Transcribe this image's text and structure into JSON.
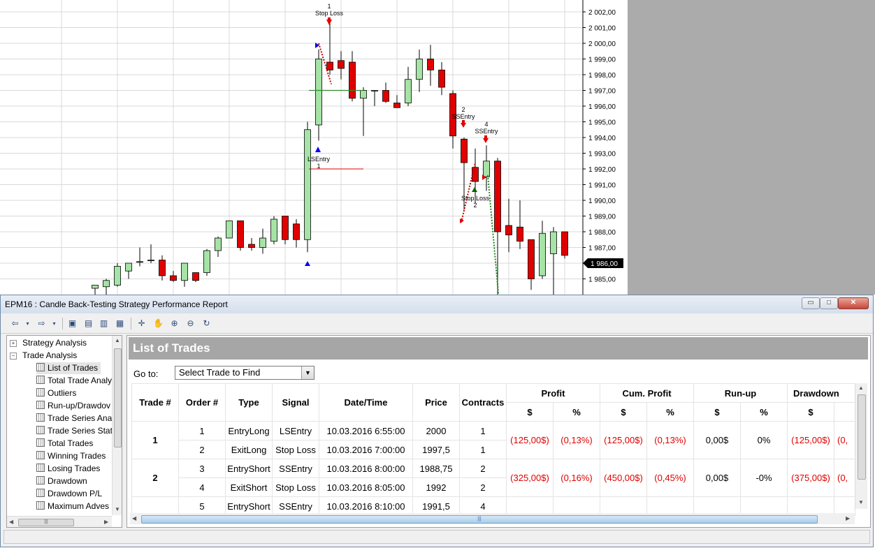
{
  "chart": {
    "price_labels": [
      "2 002,00",
      "2 001,00",
      "2 000,00",
      "1 999,00",
      "1 998,00",
      "1 997,00",
      "1 996,00",
      "1 995,00",
      "1 994,00",
      "1 993,00",
      "1 992,00",
      "1 991,00",
      "1 990,00",
      "1 989,00",
      "1 988,00",
      "1 987,00",
      "1 986,00",
      "1 985,00"
    ],
    "last_price": "1 986,00",
    "bull_color": "#a6e3a6",
    "bear_color": "#e00000",
    "annotations": [
      {
        "lines": [
          "1",
          "Stop Loss"
        ]
      },
      {
        "lines": [
          "LSEntry",
          "1"
        ]
      },
      {
        "lines": [
          "2",
          "SSEntry"
        ]
      },
      {
        "lines": [
          "4",
          "SSEntry"
        ]
      },
      {
        "lines": [
          "Stop Loss",
          "2"
        ]
      }
    ]
  },
  "window": {
    "title": "EPM16 : Candle Back-Testing Strategy Performance Report",
    "minimize_label": "▭",
    "maximize_label": "□",
    "close_label": "✕"
  },
  "toolbar": {
    "icons": [
      "back-icon",
      "dropdown-icon",
      "forward-icon",
      "dropdown-icon",
      "save-icon",
      "print-preview-icon",
      "print-icon",
      "settings-icon",
      "crosshair-icon",
      "hand-icon",
      "zoom-in-icon",
      "zoom-out-icon",
      "refresh-icon"
    ]
  },
  "tree": {
    "items": [
      {
        "label": "Strategy Analysis",
        "level": 0,
        "expander": "+"
      },
      {
        "label": "Trade Analysis",
        "level": 0,
        "expander": "−"
      },
      {
        "label": "List of Trades",
        "level": 1,
        "selected": true
      },
      {
        "label": "Total Trade Analy",
        "level": 1
      },
      {
        "label": "Outliers",
        "level": 1
      },
      {
        "label": "Run-up/Drawdov",
        "level": 1
      },
      {
        "label": "Trade Series Anal",
        "level": 1
      },
      {
        "label": "Trade Series Stati",
        "level": 1
      },
      {
        "label": "Total Trades",
        "level": 1
      },
      {
        "label": "Winning Trades",
        "level": 1
      },
      {
        "label": "Losing Trades",
        "level": 1
      },
      {
        "label": "Drawdown",
        "level": 1
      },
      {
        "label": "Drawdown P/L",
        "level": 1
      },
      {
        "label": "Maximum Adves",
        "level": 1
      }
    ]
  },
  "report": {
    "header": "List of Trades",
    "goto_label": "Go to:",
    "goto_value": "Select Trade to Find",
    "columns": {
      "trade": "Trade #",
      "order": "Order #",
      "type": "Type",
      "signal": "Signal",
      "datetime": "Date/Time",
      "price": "Price",
      "contracts": "Contracts",
      "profit": "Profit",
      "cum_profit": "Cum. Profit",
      "runup": "Run-up",
      "drawdown": "Drawdown"
    },
    "units": {
      "dollar": "$",
      "percent": "%"
    },
    "trades": [
      {
        "trade": "1",
        "profit_usd": "(125,00$)",
        "profit_pct": "(0,13%)",
        "cum_usd": "(125,00$)",
        "cum_pct": "(0,13%)",
        "runup_usd": "0,00$",
        "runup_pct": "0%",
        "dd_usd": "(125,00$)",
        "dd_pct": "(0,",
        "orders": [
          {
            "order": "1",
            "type": "EntryLong",
            "signal": "LSEntry",
            "datetime": "10.03.2016 6:55:00",
            "price": "2000",
            "contracts": "1"
          },
          {
            "order": "2",
            "type": "ExitLong",
            "signal": "Stop Loss",
            "datetime": "10.03.2016 7:00:00",
            "price": "1997,5",
            "contracts": "1"
          }
        ]
      },
      {
        "trade": "2",
        "profit_usd": "(325,00$)",
        "profit_pct": "(0,16%)",
        "cum_usd": "(450,00$)",
        "cum_pct": "(0,45%)",
        "runup_usd": "0,00$",
        "runup_pct": "-0%",
        "dd_usd": "(375,00$)",
        "dd_pct": "(0,",
        "orders": [
          {
            "order": "3",
            "type": "EntryShort",
            "signal": "SSEntry",
            "datetime": "10.03.2016 8:00:00",
            "price": "1988,75",
            "contracts": "2"
          },
          {
            "order": "4",
            "type": "ExitShort",
            "signal": "Stop Loss",
            "datetime": "10.03.2016 8:05:00",
            "price": "1992",
            "contracts": "2"
          }
        ]
      },
      {
        "trade": "",
        "orders": [
          {
            "order": "5",
            "type": "EntryShort",
            "signal": "SSEntry",
            "datetime": "10.03.2016 8:10:00",
            "price": "1991,5",
            "contracts": "4"
          }
        ]
      }
    ]
  }
}
